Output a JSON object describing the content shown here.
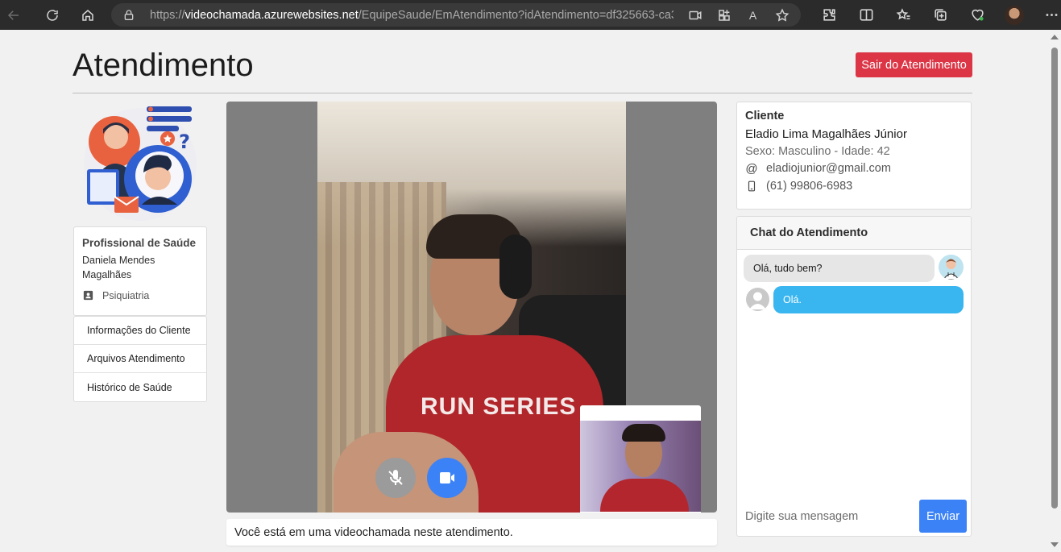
{
  "browser": {
    "url_scheme": "https://",
    "url_host": "videochamada.azurewebsites.net",
    "url_path": "/EquipeSaude/EmAtendimento?idAtendimento=df325663-ca3...",
    "reader_icon_label": "A"
  },
  "page": {
    "title": "Atendimento",
    "exit_button": "Sair do Atendimento"
  },
  "professional": {
    "heading": "Profissional de Saúde",
    "name": "Daniela Mendes Magalhães",
    "specialty": "Psiquiatria"
  },
  "menu": {
    "items": [
      {
        "label": "Informações do Cliente"
      },
      {
        "label": "Arquivos Atendimento"
      },
      {
        "label": "Histórico de Saúde"
      }
    ]
  },
  "video": {
    "shirt_text": "RUN SERIES",
    "caption": "Você está em uma videochamada neste atendimento."
  },
  "client": {
    "heading": "Cliente",
    "name": "Eladio Lima Magalhães Júnior",
    "info": "Sexo: Masculino - Idade: 42",
    "email": "eladiojunior@gmail.com",
    "phone": "(61) 99806-6983"
  },
  "chat": {
    "heading": "Chat do Atendimento",
    "messages": [
      {
        "text": "Olá, tudo bem?",
        "from": "professional"
      },
      {
        "text": "Olá.",
        "from": "client"
      }
    ],
    "input_placeholder": "Digite sua mensagem",
    "send_label": "Enviar"
  },
  "colors": {
    "danger": "#dc3545",
    "primary": "#3b82f6",
    "chat_out": "#39b5ef"
  }
}
